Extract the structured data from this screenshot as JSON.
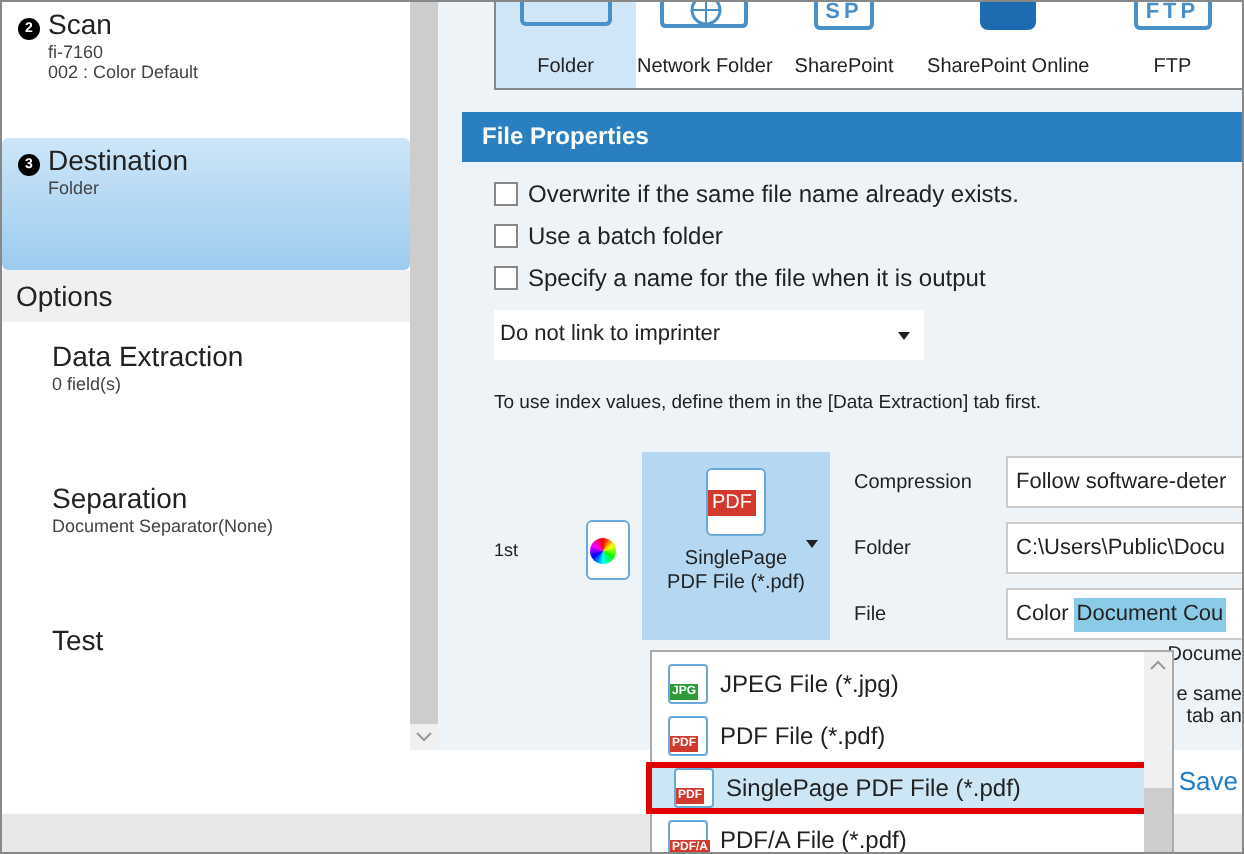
{
  "sidebar": {
    "steps": [
      {
        "number": "2",
        "title": "Scan",
        "details": [
          "fi-7160",
          "002 : Color Default"
        ],
        "selected": false
      },
      {
        "number": "3",
        "title": "Destination",
        "details": [
          "Folder"
        ],
        "selected": true
      }
    ],
    "options_header": "Options",
    "options": [
      {
        "title": "Data Extraction",
        "details": [
          "0 field(s)"
        ]
      },
      {
        "title": "Separation",
        "details": [
          "Document Separator(None)"
        ]
      },
      {
        "title": "Test"
      }
    ]
  },
  "destinations": [
    {
      "label": "Folder",
      "kind": "folder",
      "selected": true
    },
    {
      "label": "Network Folder",
      "kind": "network",
      "selected": false
    },
    {
      "label": "SharePoint",
      "kind": "sp",
      "icon_text": "SP",
      "selected": false
    },
    {
      "label": "SharePoint Online",
      "kind": "spo",
      "selected": false
    },
    {
      "label": "FTP",
      "kind": "ftp",
      "icon_text": "FTP",
      "selected": false
    }
  ],
  "file_properties": {
    "title": "File Properties",
    "checkboxes": [
      {
        "label": "Overwrite if the same file name already exists.",
        "checked": false
      },
      {
        "label": "Use a batch folder",
        "checked": false
      },
      {
        "label": "Specify a name for the file when it is output",
        "checked": false
      }
    ],
    "imprinter": {
      "value": "Do not link to imprinter"
    },
    "note": "To use index values, define them in the [Data Extraction] tab first.",
    "row": {
      "label": "1st",
      "format_button": {
        "icon_text": "PDF",
        "label": "SinglePage PDF File (*.pdf)"
      },
      "fields": [
        {
          "label": "Compression",
          "value": "Follow software-deter"
        },
        {
          "label": "Folder",
          "value": "C:\\Users\\Public\\Docu"
        },
        {
          "label": "File",
          "value": "Color",
          "token": "Document Cou"
        }
      ]
    },
    "hidden_texts": [
      "Docume",
      "e same",
      "tab an"
    ],
    "save_link": "Save"
  },
  "format_menu": {
    "items": [
      {
        "label": "JPEG File (*.jpg)",
        "icon_text": "JPG",
        "color": "#2e9a3c",
        "selected": false
      },
      {
        "label": "PDF File (*.pdf)",
        "icon_text": "PDF",
        "color": "#d23a2e",
        "selected": false
      },
      {
        "label": "SinglePage PDF File (*.pdf)",
        "icon_text": "PDF",
        "color": "#d23a2e",
        "selected": true
      },
      {
        "label": "PDF/A File (*.pdf)",
        "icon_text": "PDF/A",
        "color": "#d23a2e",
        "selected": false
      }
    ]
  }
}
